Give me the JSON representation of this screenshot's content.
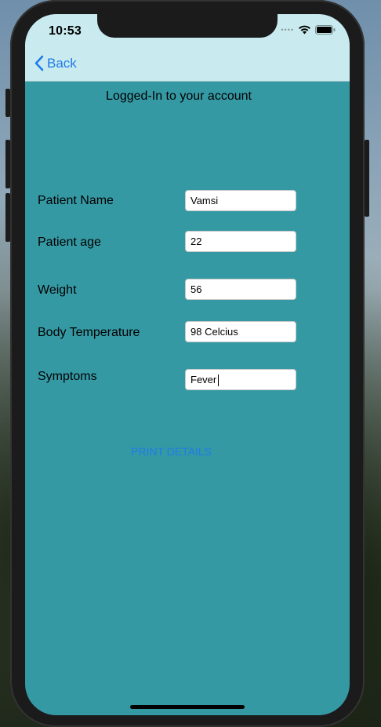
{
  "status_bar": {
    "time": "10:53",
    "signal_icon": "signal-dots",
    "wifi_icon": "wifi",
    "battery_icon": "battery"
  },
  "nav": {
    "back_label": "Back",
    "back_icon": "chevron-left"
  },
  "content": {
    "title": "Logged-In to your account"
  },
  "form": {
    "fields": [
      {
        "label": "Patient Name",
        "value": "Vamsi"
      },
      {
        "label": "Patient age",
        "value": "22"
      },
      {
        "label": "Weight",
        "value": "56"
      },
      {
        "label": "Body Temperature",
        "value": "98 Celcius"
      },
      {
        "label": "Symptoms",
        "value": "Fever"
      }
    ]
  },
  "actions": {
    "print_label": "PRINT DETAILS"
  },
  "colors": {
    "background": "#3599a4",
    "nav_background": "#c9ebef",
    "accent": "#1f7be8"
  }
}
